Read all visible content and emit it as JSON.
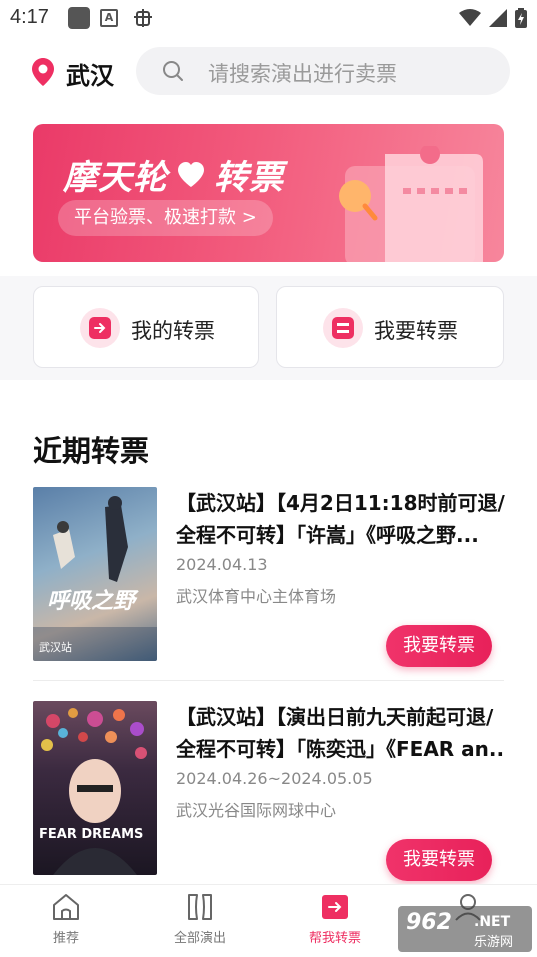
{
  "status_bar": {
    "time": "4:17",
    "a_badge": "A"
  },
  "header": {
    "city": "武汉",
    "search_placeholder": "请搜索演出进行卖票"
  },
  "banner": {
    "title_part1": "摩天轮",
    "title_part2": "转票",
    "pill": "平台验票、极速打款 >"
  },
  "quick_actions": [
    {
      "label": "我的转票",
      "icon": "arrow-right-icon"
    },
    {
      "label": "我要转票",
      "icon": "ticket-icon"
    }
  ],
  "section": {
    "title": "近期转票"
  },
  "items": [
    {
      "title_line1": "【武汉站】【4月2日11:18时前可退/",
      "title_line2": "全程不可转】「许嵩」《呼吸之野...",
      "date": "2024.04.13",
      "venue": "武汉体育中心主体育场",
      "button": "我要转票",
      "poster_text": "呼吸之野",
      "poster_sub": "武汉站"
    },
    {
      "title_line1": "【武汉站】【演出日前九天前起可退/",
      "title_line2": "全程不可转】「陈奕迅」《FEAR an...",
      "date": "2024.04.26~2024.05.05",
      "venue": "武汉光谷国际网球中心",
      "button": "我要转票",
      "poster_text": "FEAR DREAMS"
    }
  ],
  "tabbar": [
    {
      "label": "推荐",
      "icon": "home-icon",
      "active": false
    },
    {
      "label": "全部演出",
      "icon": "shows-icon",
      "active": false
    },
    {
      "label": "帮我转票",
      "icon": "transfer-icon",
      "active": true
    },
    {
      "label": "",
      "icon": "profile-icon",
      "active": false
    }
  ],
  "watermark": {
    "num": "962",
    "net": ".NET",
    "text": "乐游网"
  },
  "colors": {
    "accent": "#ee2f62",
    "banner_start": "#ea3a68",
    "banner_end": "#f7869c"
  }
}
